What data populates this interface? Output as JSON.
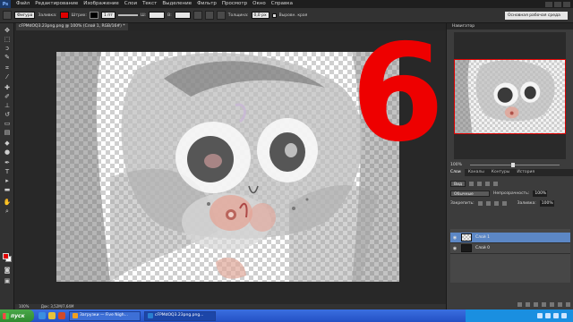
{
  "menubar": {
    "logo": "Ps",
    "items": [
      "Файл",
      "Редактирование",
      "Изображение",
      "Слои",
      "Текст",
      "Выделение",
      "Фильтр",
      "Просмотр",
      "Окно",
      "Справка"
    ]
  },
  "options": {
    "shape_mode": "Фигура",
    "fill_label": "Заливка:",
    "stroke_label": "Штрих:",
    "stroke_width": "1 пт",
    "w_label": "Ш:",
    "h_label": "В:",
    "thickness_label": "Толщина:",
    "thickness_value": "0,0 px",
    "align_edges_label": "Выровн. края",
    "workspace": "Основная рабочая среда",
    "fill_color": "#e00000",
    "stroke_color": "#000000"
  },
  "document": {
    "tab_title": "cFPMdOQ3.23png.png @ 100% (Слой 1, RGB/16#) *",
    "overlay_number": "6",
    "overlay_color": "#ee0000"
  },
  "status": {
    "zoom": "100%",
    "doc_size": "Док: 3,52M/7,64M"
  },
  "navigator": {
    "title": "Навигатор",
    "zoom": "100%"
  },
  "panel_tabs": [
    {
      "label": "Слои",
      "active": true
    },
    {
      "label": "Каналы",
      "active": false
    },
    {
      "label": "Контуры",
      "active": false
    },
    {
      "label": "История",
      "active": false
    }
  ],
  "layers": {
    "filter_label": "Вид",
    "blend_mode": "Обычные",
    "opacity_label": "Непрозрачность:",
    "opacity_value": "100%",
    "lock_label": "Закрепить:",
    "fill_label": "Заливка:",
    "fill_value": "100%",
    "rows": [
      {
        "name": "Слой 1",
        "active": true
      },
      {
        "name": "Слой 0",
        "active": false
      }
    ]
  },
  "taskbar": {
    "start_label": "пуск",
    "tasks": [
      {
        "label": "Загрузки — Five Nigh...",
        "icon_color": "#f0a020",
        "active": false
      },
      {
        "label": "cFPMdOQ3.23png.png...",
        "icon_color": "#2a7fd0",
        "active": true
      }
    ],
    "tray_time": ""
  }
}
